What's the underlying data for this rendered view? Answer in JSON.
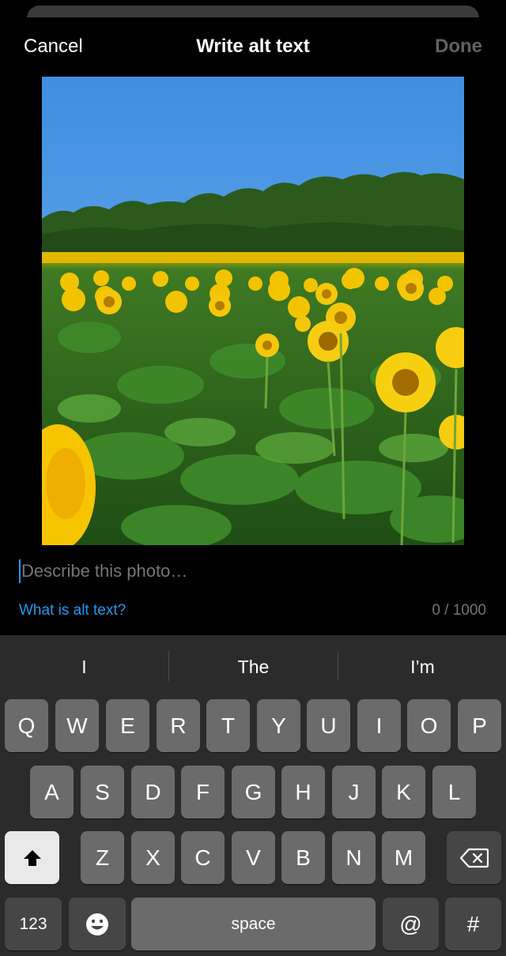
{
  "header": {
    "cancel": "Cancel",
    "title": "Write alt text",
    "done": "Done"
  },
  "photo": {
    "label": "sunflower-field-photo"
  },
  "input": {
    "placeholder": "Describe this photo…",
    "value": ""
  },
  "footer": {
    "link": "What is alt text?",
    "counter": "0 / 1000"
  },
  "keyboard": {
    "suggestions": [
      "I",
      "The",
      "I’m"
    ],
    "row1": [
      "Q",
      "W",
      "E",
      "R",
      "T",
      "Y",
      "U",
      "I",
      "O",
      "P"
    ],
    "row2": [
      "A",
      "S",
      "D",
      "F",
      "G",
      "H",
      "J",
      "K",
      "L"
    ],
    "row3": [
      "Z",
      "X",
      "C",
      "V",
      "B",
      "N",
      "M"
    ],
    "numbers": "123",
    "space": "space",
    "at": "@",
    "hash": "#"
  },
  "colors": {
    "accent": "#1d9bf0",
    "muted": "#6e767d",
    "done_disabled": "#5e6267"
  },
  "icons": {
    "shift": "shift-icon",
    "backspace": "backspace-icon",
    "emoji": "emoji-icon"
  }
}
